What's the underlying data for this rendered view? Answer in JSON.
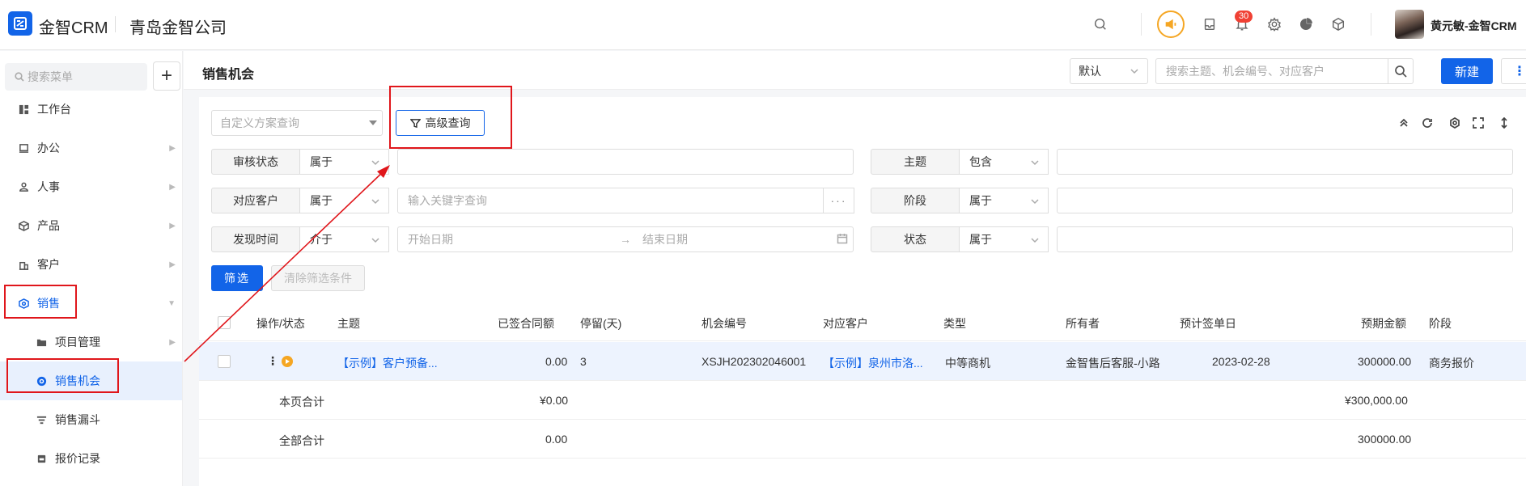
{
  "header": {
    "brand": "金智CRM",
    "company": "青岛金智公司",
    "notification_count": "30",
    "user_name": "黄元敏-金智CRM"
  },
  "sidebar": {
    "search_placeholder": "搜索菜单",
    "add_label": "+",
    "items": [
      {
        "label": "工作台",
        "icon": "dashboard-icon"
      },
      {
        "label": "办公",
        "icon": "monitor-icon"
      },
      {
        "label": "人事",
        "icon": "people-icon"
      },
      {
        "label": "产品",
        "icon": "box-icon"
      },
      {
        "label": "客户",
        "icon": "building-icon"
      },
      {
        "label": "销售",
        "icon": "target-icon"
      }
    ],
    "sub_items": [
      {
        "label": "项目管理",
        "icon": "folder-icon"
      },
      {
        "label": "销售机会",
        "icon": "opportunity-icon"
      },
      {
        "label": "销售漏斗",
        "icon": "funnel-icon"
      },
      {
        "label": "报价记录",
        "icon": "quote-icon"
      }
    ]
  },
  "titlebar": {
    "title": "销售机会",
    "view_select": "默认",
    "search_placeholder": "搜索主题、机会编号、对应客户",
    "new_label": "新建",
    "more_label": "⋮"
  },
  "filters": {
    "scheme_placeholder": "自定义方案查询",
    "advanced_label": "高级查询",
    "rows": [
      {
        "label": "审核状态",
        "op": "属于",
        "value": ""
      },
      {
        "label": "对应客户",
        "op": "属于",
        "value": "输入关键字查询"
      },
      {
        "label": "发现时间",
        "op": "介于",
        "start": "开始日期",
        "end": "结束日期"
      }
    ],
    "right_rows": [
      {
        "label": "主题",
        "op": "包含"
      },
      {
        "label": "阶段",
        "op": "属于"
      },
      {
        "label": "状态",
        "op": "属于"
      }
    ],
    "filter_btn": "筛选",
    "clear_btn": "清除筛选条件"
  },
  "table": {
    "columns": [
      "操作/状态",
      "主题",
      "已签合同额",
      "停留(天)",
      "机会编号",
      "对应客户",
      "类型",
      "所有者",
      "预计签单日",
      "预期金额",
      "阶段"
    ],
    "rows": [
      {
        "subject": "【示例】客户预备...",
        "signed": "0.00",
        "stay": "3",
        "code": "XSJH202302046001",
        "customer": "【示例】泉州市洛...",
        "type": "中等商机",
        "owner": "金智售后客服-小路",
        "date": "2023-02-28",
        "amount": "300000.00",
        "stage": "商务报价"
      }
    ],
    "page_total": {
      "label": "本页合计",
      "signed": "¥0.00",
      "amount": "¥300,000.00"
    },
    "all_total": {
      "label": "全部合计",
      "signed": "0.00",
      "amount": "300000.00"
    }
  },
  "colors": {
    "accent": "#1264e8",
    "annotation_red": "#e0161b",
    "status_orange": "#f5a623"
  }
}
